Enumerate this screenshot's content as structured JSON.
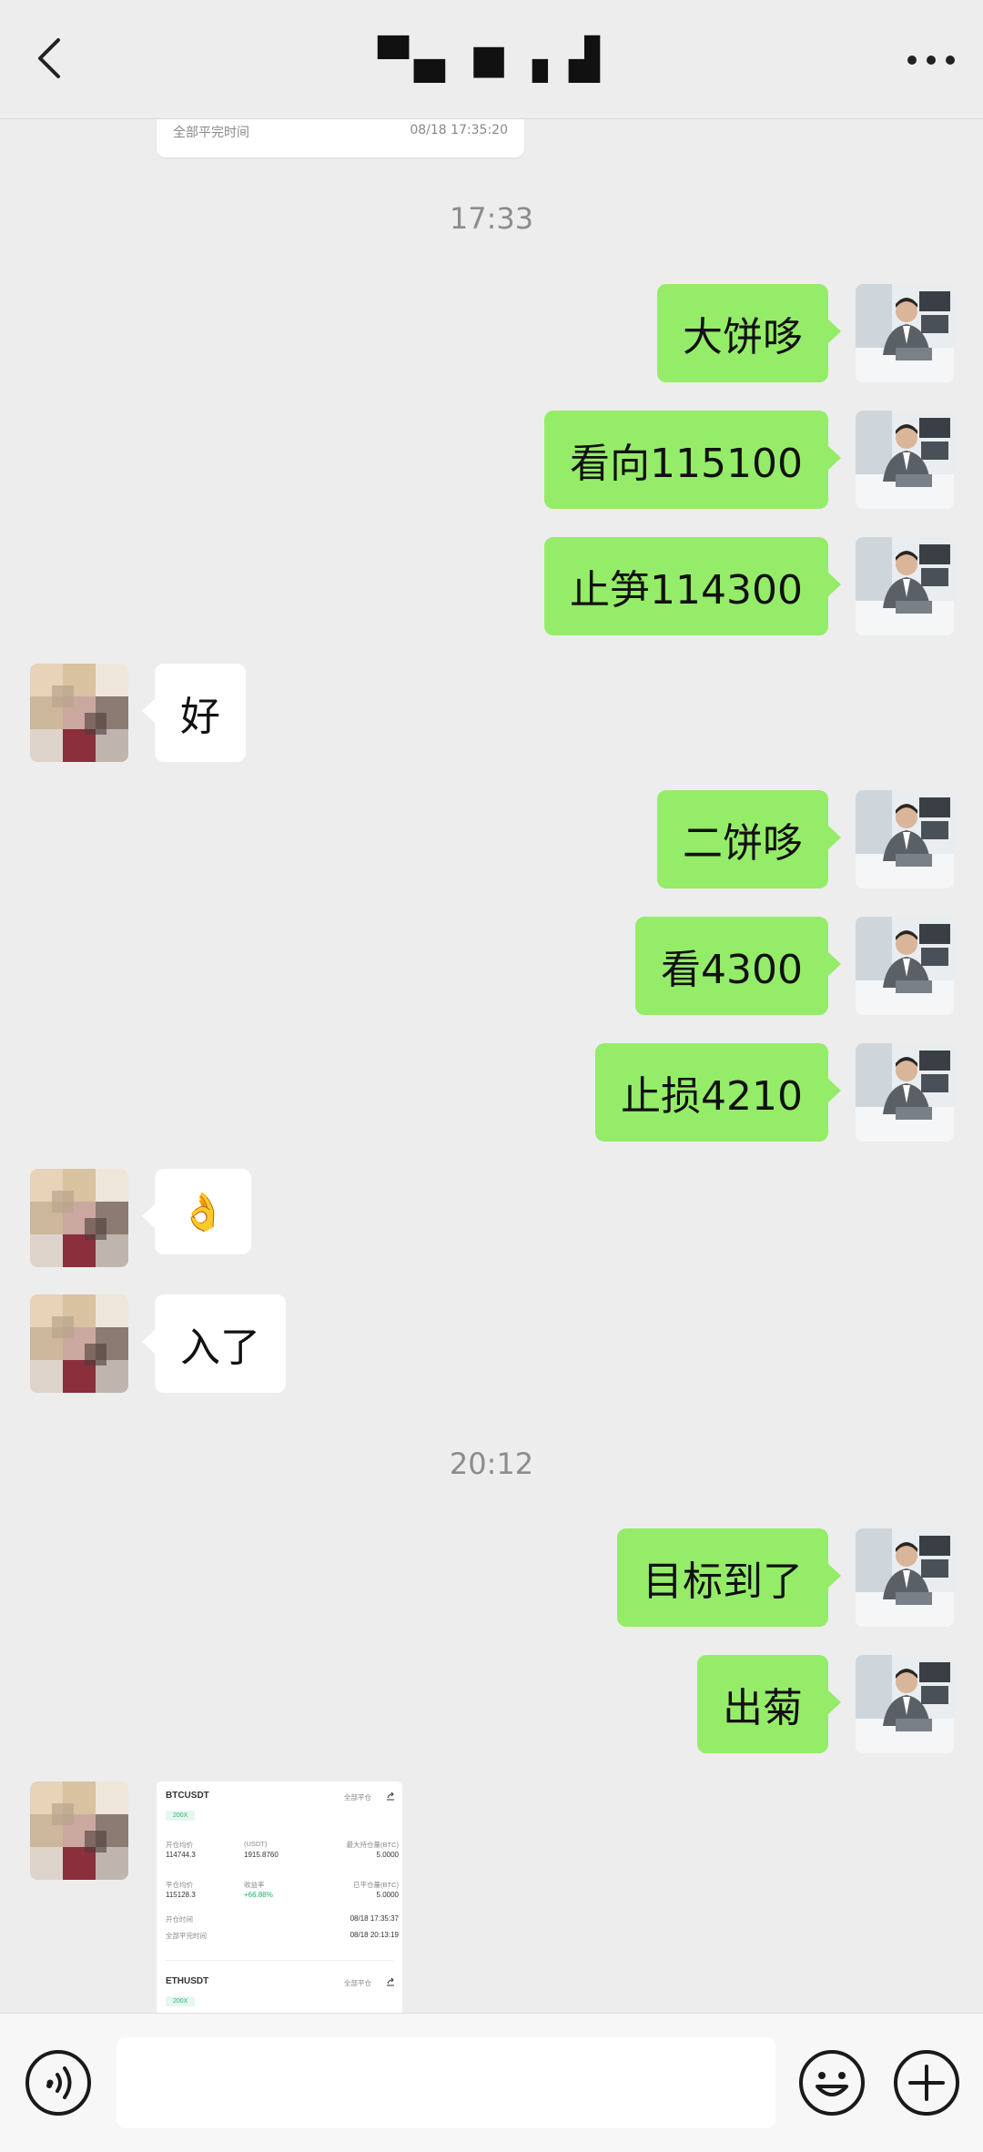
{
  "header": {
    "title": "▀▄ ■ ▖▟",
    "back_icon": "chevron-left-icon",
    "more_icon": "more-horizontal-icon"
  },
  "chat": {
    "top_card": {
      "label": "全部平完时间",
      "time": "08/18 17:35:20"
    },
    "timestamps": [
      "17:33",
      "20:12"
    ],
    "messages": [
      {
        "side": "me",
        "text": "大饼哆"
      },
      {
        "side": "me",
        "text": "看向115100"
      },
      {
        "side": "me",
        "text": "止笋114300"
      },
      {
        "side": "them",
        "text": "好"
      },
      {
        "side": "me",
        "text": "二饼哆"
      },
      {
        "side": "me",
        "text": "看4300"
      },
      {
        "side": "me",
        "text": "止损4210"
      },
      {
        "side": "them",
        "text": "👌"
      },
      {
        "side": "them",
        "text": "入了"
      },
      {
        "side": "me",
        "text": "目标到了"
      },
      {
        "side": "me",
        "text": "出菊"
      }
    ],
    "screenshot_card": {
      "symbol1": "BTCUSDT",
      "mode1": "全部平仓",
      "leverage1": "200X",
      "open_price_label": "开仓均价",
      "open_price": "114744.3",
      "pnl_label": "(USDT)",
      "pnl": "1915.8760",
      "max_hold_label": "最大持仓量(BTC)",
      "max_hold": "5.0000",
      "close_price_label": "平仓均价",
      "close_price": "115128.3",
      "rate_label": "收益率",
      "rate": "+66.88%",
      "closed_label": "已平仓量(BTC)",
      "closed": "5.0000",
      "open_time_label": "开仓时间",
      "open_time": "08/18 17:35:37",
      "close_time_label": "全部平完时间",
      "close_time": "08/18 20:13:19",
      "symbol2": "ETHUSDT",
      "mode2": "全部平仓",
      "leverage2": "200X"
    }
  },
  "input_bar": {
    "placeholder": "",
    "voice_icon": "voice-icon",
    "emoji_icon": "emoji-icon",
    "plus_icon": "plus-circle-icon"
  },
  "colors": {
    "bg": "#ededed",
    "my_bubble": "#95ec69",
    "their_bubble": "#ffffff",
    "timestamp": "#8c8c8c"
  }
}
